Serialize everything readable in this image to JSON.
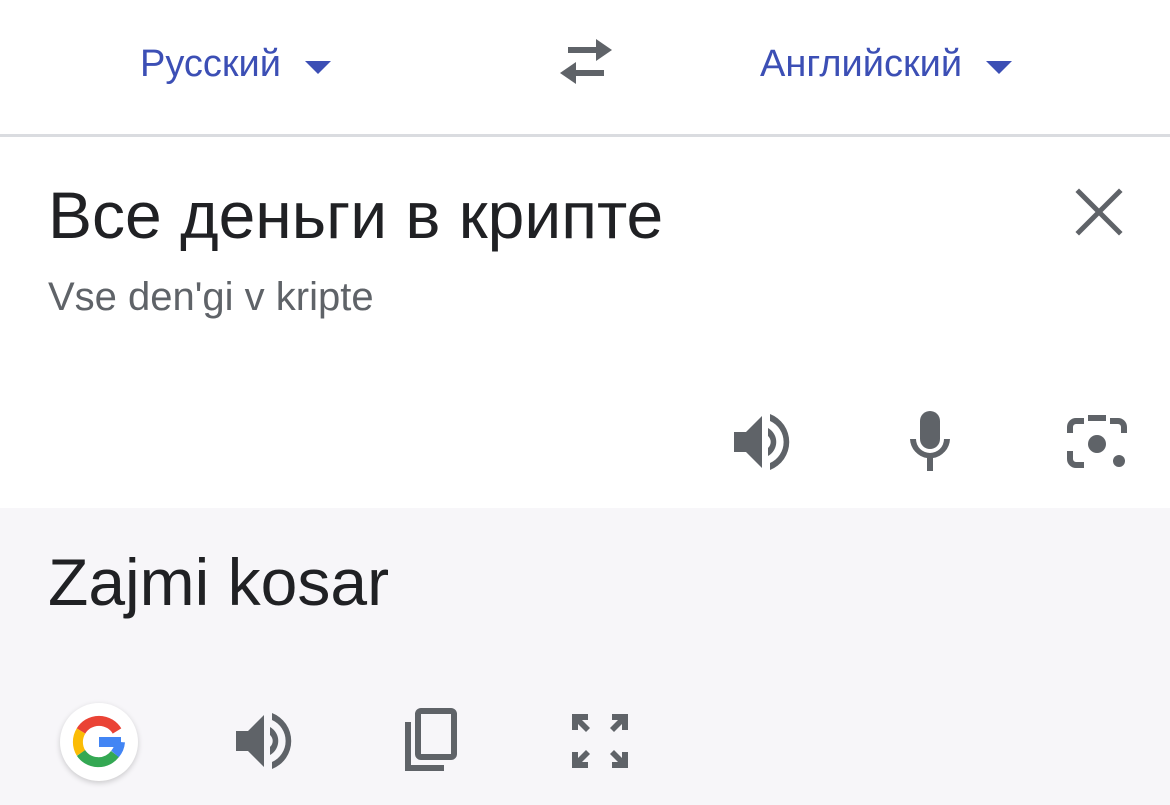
{
  "header": {
    "source_language": "Русский",
    "target_language": "Английский"
  },
  "source": {
    "text": "Все деньги в крипте",
    "transliteration": "Vse den'gi v kripte"
  },
  "result": {
    "text": "Zajmi kosar"
  },
  "icons": {
    "swap": "swap-languages-icon",
    "clear": "close-icon",
    "speak_source": "speaker-icon",
    "mic": "microphone-icon",
    "camera": "camera-lens-icon",
    "google": "google-logo-icon",
    "speak_result": "speaker-icon",
    "copy": "copy-icon",
    "fullscreen": "fullscreen-icon"
  },
  "colors": {
    "accent": "#3c4fb5",
    "icon_gray": "#5f6368",
    "result_bg": "#f7f6f9",
    "divider": "#dadce0"
  }
}
